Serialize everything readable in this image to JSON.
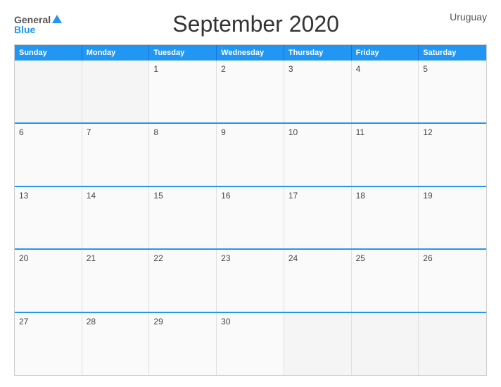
{
  "header": {
    "logo_general": "General",
    "logo_blue": "Blue",
    "title": "September 2020",
    "country": "Uruguay"
  },
  "calendar": {
    "days": [
      "Sunday",
      "Monday",
      "Tuesday",
      "Wednesday",
      "Thursday",
      "Friday",
      "Saturday"
    ],
    "weeks": [
      [
        "",
        "",
        "1",
        "2",
        "3",
        "4",
        "5"
      ],
      [
        "6",
        "7",
        "8",
        "9",
        "10",
        "11",
        "12"
      ],
      [
        "13",
        "14",
        "15",
        "16",
        "17",
        "18",
        "19"
      ],
      [
        "20",
        "21",
        "22",
        "23",
        "24",
        "25",
        "26"
      ],
      [
        "27",
        "28",
        "29",
        "30",
        "",
        "",
        ""
      ]
    ]
  }
}
